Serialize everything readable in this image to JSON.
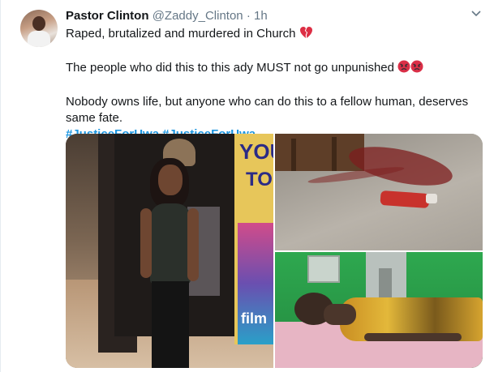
{
  "tweet": {
    "author_name": "Pastor Clinton",
    "author_handle": "@Zaddy_Clinton",
    "separator": "·",
    "time": "1h",
    "text_line_1": "Raped, brutalized and murdered in Church",
    "text_line_2": "The people who did this to this ady MUST not go unpunished",
    "text_line_3": "Nobody owns life, but anyone who can do this to a fellow human, deserves same fate.",
    "hashtags": [
      "#JusticeForUwa",
      "#JusticeForUwa"
    ],
    "icons": {
      "line_1_emoji": "broken-heart-icon",
      "line_2_emojis": [
        "angry-face-icon",
        "angry-face-icon"
      ],
      "menu": "chevron-down-icon"
    }
  },
  "media": {
    "photo_1_text": [
      "YOU",
      "TO",
      "film"
    ],
    "photo_count": 3
  },
  "colors": {
    "link": "#1b95e0",
    "secondary_text": "#657786",
    "primary_text": "#14171a"
  }
}
